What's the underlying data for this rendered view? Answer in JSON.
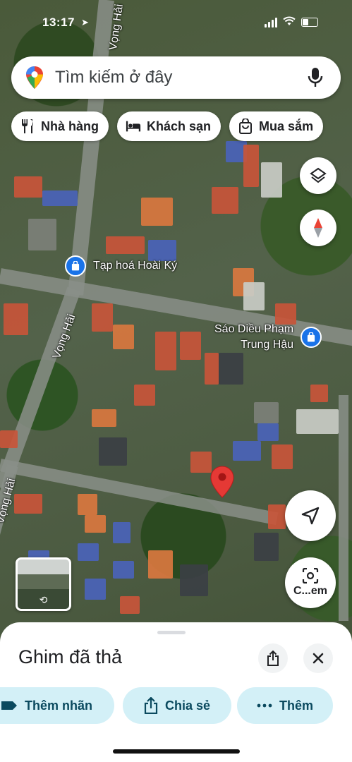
{
  "status_bar": {
    "time": "13:17"
  },
  "search": {
    "placeholder": "Tìm kiếm ở đây",
    "logo_icon": "maps-pin-icon",
    "mic_icon": "mic-icon"
  },
  "chips": [
    {
      "label": "Nhà hàng",
      "icon": "restaurant-icon"
    },
    {
      "label": "Khách sạn",
      "icon": "hotel-icon"
    },
    {
      "label": "Mua sắm",
      "icon": "shopping-bag-icon"
    }
  ],
  "map": {
    "pois": [
      {
        "label": "Tạp hoá Hoài Ký",
        "icon": "shopping-bag-icon"
      },
      {
        "label_line1": "Sáo Diều Phạm",
        "label_line2": "Trung Hậu",
        "icon": "shopping-bag-icon"
      }
    ],
    "streets": [
      "Vọng Hải",
      "Vọng Hải",
      "Vọng Hải"
    ],
    "dropped_pin_color": "#e53935"
  },
  "fabs": {
    "layers_icon": "layers-icon",
    "compass_icon": "compass-icon",
    "directions_icon": "navigate-icon",
    "camera_label": "C...em"
  },
  "sheet": {
    "title": "Ghim đã thả",
    "share_icon": "share-icon",
    "close_icon": "close-icon",
    "actions": [
      {
        "label": "Thêm nhãn",
        "icon": "label-icon"
      },
      {
        "label": "Chia sẻ",
        "icon": "share-icon"
      },
      {
        "label": "Thêm",
        "icon": "more-icon"
      }
    ]
  },
  "colors": {
    "accent": "#1a73e8",
    "action_bg": "#d3f0f7",
    "action_text": "#0b4a5f"
  }
}
